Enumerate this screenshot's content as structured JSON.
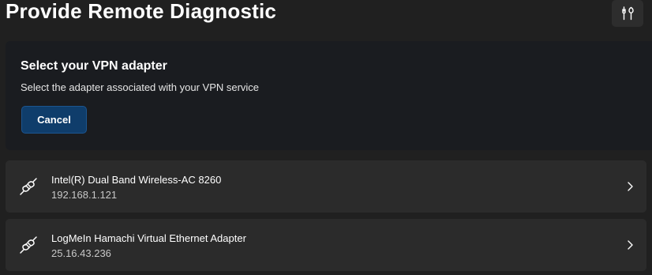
{
  "header": {
    "title": "Provide Remote Diagnostic",
    "tools_icon": "tools-icon"
  },
  "vpn_card": {
    "title": "Select your VPN adapter",
    "description": "Select the adapter associated with your VPN service",
    "cancel_label": "Cancel"
  },
  "adapters": [
    {
      "name": "Intel(R) Dual Band Wireless-AC 8260",
      "ip": "192.168.1.121",
      "icon": "plug-icon"
    },
    {
      "name": "LogMeIn Hamachi Virtual Ethernet Adapter",
      "ip": "25.16.43.236",
      "icon": "plug-icon"
    }
  ],
  "colors": {
    "background": "#202020",
    "card": "#1a1c20",
    "row": "#2b2b2b",
    "accent_button": "#0f3d6b"
  }
}
